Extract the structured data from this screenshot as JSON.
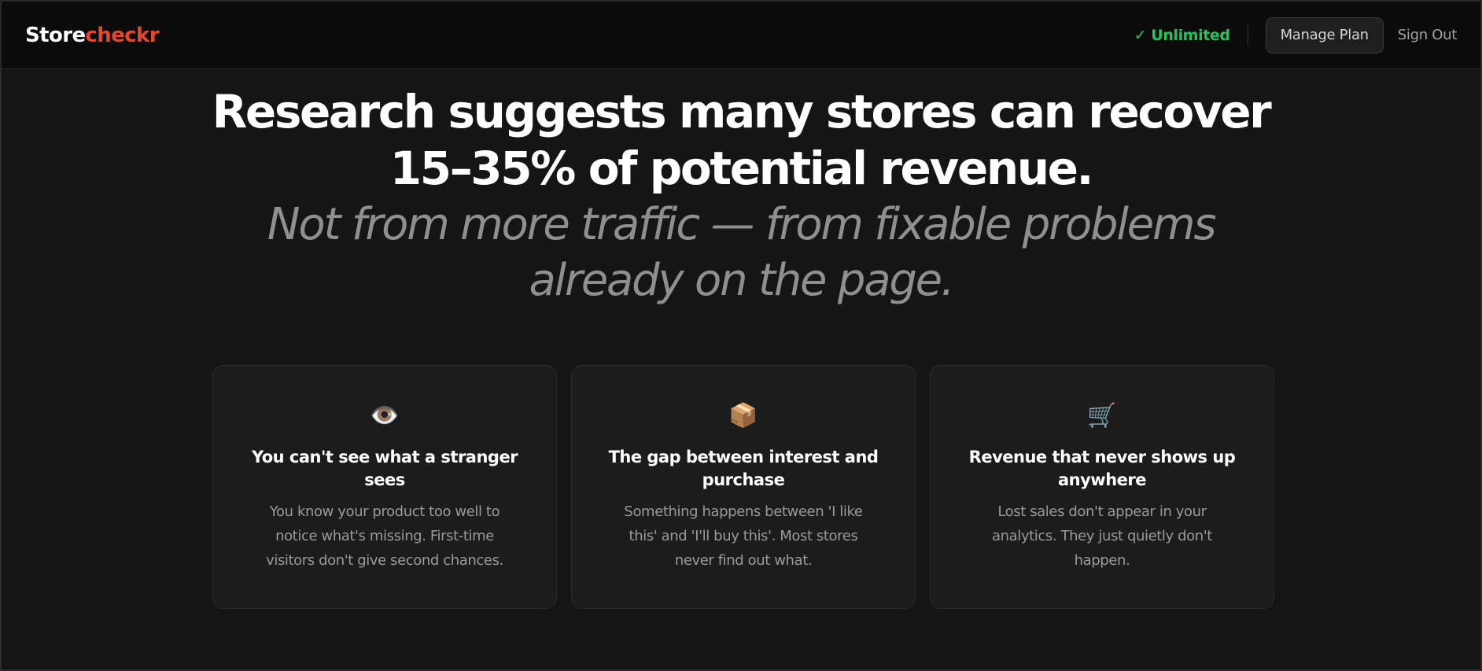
{
  "header": {
    "logo_part_a": "Store",
    "logo_part_b": "checkr",
    "plan_badge": "✓ Unlimited",
    "manage_label": "Manage Plan",
    "signout_label": "Sign Out"
  },
  "hero": {
    "headline_line1": "Research suggests many stores can recover",
    "headline_line2": "15–35% of potential revenue.",
    "sub_line1": "Not from more traffic — from fixable problems",
    "sub_line2": "already on the page."
  },
  "cards": [
    {
      "icon": "👁️",
      "icon_name": "eye-icon",
      "title": "You can't see what a stranger sees",
      "body": "You know your product too well to notice what's missing. First-time visitors don't give second chances."
    },
    {
      "icon": "📦",
      "icon_name": "package-icon",
      "title": "The gap between interest and purchase",
      "body": "Something happens between 'I like this' and 'I'll buy this'. Most stores never find out what."
    },
    {
      "icon": "🛒",
      "icon_name": "shopping-cart-icon",
      "title": "Revenue that never shows up anywhere",
      "body": "Lost sales don't appear in your analytics. They just quietly don't happen."
    }
  ],
  "colors": {
    "brand_accent": "#e8472c",
    "plan_green": "#22c55e",
    "background": "#151515",
    "card_background": "#1c1c1c"
  }
}
